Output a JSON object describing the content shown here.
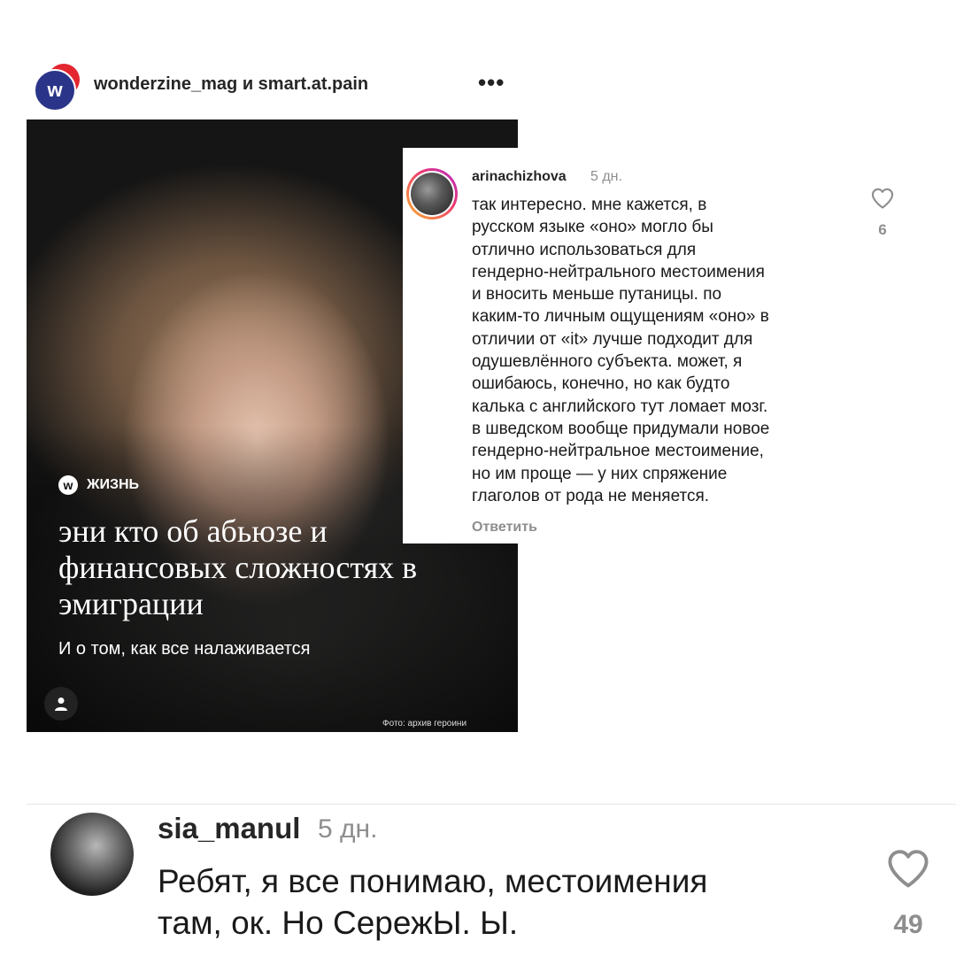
{
  "post": {
    "author": "wonderzine_mag и smart.at.pain",
    "avatar_letter": "w",
    "more_icon": "•••",
    "image": {
      "category_badge": "w",
      "category": "ЖИЗНЬ",
      "title": "эни кто об абьюзе и финансовых сложностях в эмиграции",
      "subtitle": "И о том, как все налаживается",
      "photo_credit": "Фото: архив героини"
    }
  },
  "comments": [
    {
      "username": "arinachizhova",
      "time": "5 дн.",
      "text": "так интересно. мне кажется, в\nрусском языке «оно» могло бы\nотлично использоваться для\nгендерно-нейтрального местоимения\nи вносить меньше путаницы. по\nкаким-то личным ощущениям «оно» в\nотличии от «it» лучше подходит для\nодушевлённого субъекта. может, я\nошибаюсь, конечно, но как будто\nкалька с английского тут ломает мозг.\nв шведском вообще придумали новое\nгендерно-нейтральное местоимение,\nно им проще — у них спряжение\nглаголов от рода не меняется.",
      "reply_label": "Ответить",
      "likes": "6"
    },
    {
      "username": "sia_manul",
      "time": "5 дн.",
      "text": "Ребят, я все понимаю, местоимения\nтам, ок. Но СережЫ. Ы.",
      "likes": "49"
    }
  ],
  "colors": {
    "brand_red": "#e3262f",
    "brand_blue": "#2a3589",
    "muted_text": "#8e8e8e"
  }
}
